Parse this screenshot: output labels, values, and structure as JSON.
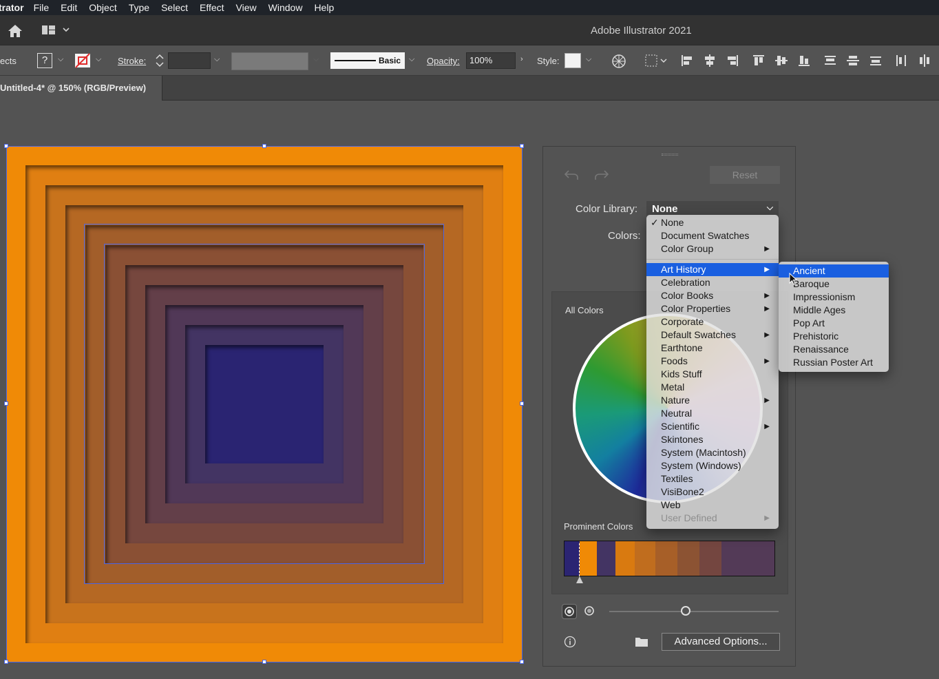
{
  "menubar": {
    "app": "trator",
    "items": [
      "File",
      "Edit",
      "Object",
      "Type",
      "Select",
      "Effect",
      "View",
      "Window",
      "Help"
    ]
  },
  "appbar": {
    "title": "Adobe Illustrator 2021"
  },
  "control_bar": {
    "left_cut_label": "ects",
    "help_box": "?",
    "stroke_label": "Stroke:",
    "stroke_profile": "Basic",
    "opacity_label": "Opacity:",
    "opacity_value": "100%",
    "style_label": "Style:"
  },
  "document_tab": {
    "title": "Untitled-4* @ 150% (RGB/Preview)"
  },
  "artwork": {
    "squares": [
      "#f08a06",
      "#e07f12",
      "#c8731c",
      "#b56823",
      "#a25e2a",
      "#8a5034",
      "#76473e",
      "#633f49",
      "#513857",
      "#433463",
      "#2a2472"
    ]
  },
  "recolor_panel": {
    "reset_label": "Reset",
    "color_library_label": "Color Library:",
    "color_library_value": "None",
    "colors_label": "Colors:",
    "all_colors_label": "All Colors",
    "prominent_colors_label": "Prominent Colors",
    "prominent_colors": [
      "#2b2472",
      "#f08a06",
      "#433463",
      "#d97a10",
      "#c06d1e",
      "#a75f28",
      "#8c5333",
      "#744640",
      "#533a57"
    ],
    "advanced_label": "Advanced Options..."
  },
  "library_menu": {
    "top_items": [
      {
        "label": "None",
        "checked": true
      },
      {
        "label": "Document Swatches"
      },
      {
        "label": "Color Group",
        "submenu": true
      }
    ],
    "items": [
      {
        "label": "Art History",
        "submenu": true,
        "highlighted": true
      },
      {
        "label": "Celebration"
      },
      {
        "label": "Color Books",
        "submenu": true
      },
      {
        "label": "Color Properties",
        "submenu": true
      },
      {
        "label": "Corporate"
      },
      {
        "label": "Default Swatches",
        "submenu": true
      },
      {
        "label": "Earthtone"
      },
      {
        "label": "Foods",
        "submenu": true
      },
      {
        "label": "Kids Stuff"
      },
      {
        "label": "Metal"
      },
      {
        "label": "Nature",
        "submenu": true
      },
      {
        "label": "Neutral"
      },
      {
        "label": "Scientific",
        "submenu": true
      },
      {
        "label": "Skintones"
      },
      {
        "label": "System (Macintosh)"
      },
      {
        "label": "System (Windows)"
      },
      {
        "label": "Textiles"
      },
      {
        "label": "VisiBone2"
      },
      {
        "label": "Web"
      },
      {
        "label": "User Defined",
        "submenu": true,
        "disabled": true
      }
    ]
  },
  "art_history_submenu": {
    "items": [
      {
        "label": "Ancient",
        "highlighted": true
      },
      {
        "label": "Baroque"
      },
      {
        "label": "Impressionism"
      },
      {
        "label": "Middle Ages"
      },
      {
        "label": "Pop Art"
      },
      {
        "label": "Prehistoric"
      },
      {
        "label": "Renaissance"
      },
      {
        "label": "Russian Poster Art"
      }
    ]
  },
  "colors": {
    "accent": "#1a5fe0",
    "selection": "#4a66e8"
  }
}
